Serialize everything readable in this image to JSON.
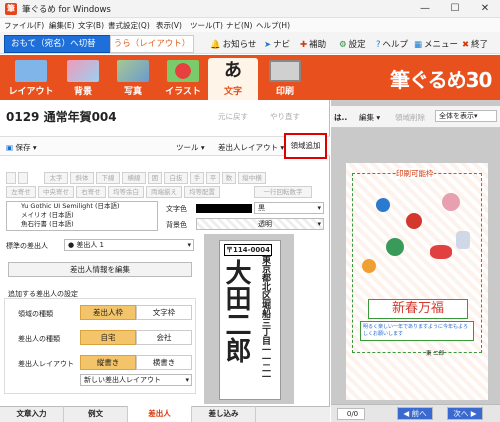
{
  "window": {
    "title": "筆ぐるめ for Windows",
    "minimize": "—",
    "maximize": "☐",
    "close": "✕"
  },
  "menu": [
    "ファイル(F)",
    "編集(E)",
    "文字(B)",
    "書式設定(Q)",
    "表示(V)",
    "ツール(T)",
    "ナビ(N)",
    "ヘルプ(H)"
  ],
  "toolbar": {
    "omote_tab": "おもて（宛名）へ切替",
    "ura_tab": "うら（レイアウト）",
    "items": [
      {
        "icon": "bell-icon",
        "label": "お知らせ",
        "color": "#d4380d"
      },
      {
        "icon": "arrow-icon",
        "label": "ナビ",
        "color": "#1a7ad0"
      },
      {
        "icon": "plus-icon",
        "label": "補助",
        "color": "#d4380d"
      },
      {
        "icon": "gear-icon",
        "label": "設定",
        "color": "#2a8a3a"
      },
      {
        "icon": "help-icon",
        "label": "ヘルプ",
        "color": "#1a7ad0"
      },
      {
        "icon": "menu-icon",
        "label": "メニュー",
        "color": "#1a7ad0"
      },
      {
        "icon": "close-icon",
        "label": "終了",
        "color": "#d4380d"
      }
    ]
  },
  "main_tabs": [
    {
      "label": "レイアウト",
      "color": "#7fb5e8"
    },
    {
      "label": "背景",
      "color": "#f29ab8"
    },
    {
      "label": "写真",
      "color": "#a8c890"
    },
    {
      "label": "イラスト",
      "color": "#7acb6a"
    },
    {
      "label": "文字",
      "color": "#ffffff"
    },
    {
      "label": "印刷",
      "color": "#d0d0d0"
    }
  ],
  "brand": "筆ぐるめ30",
  "document": {
    "title": "0129 通常年賀004",
    "undo": "元に戻す",
    "redo": "やり直す"
  },
  "controls": {
    "save": "保存",
    "tools": "ツール",
    "sender_layout": "差出人レイアウト",
    "add_area": "領域追加"
  },
  "format_rows": [
    [
      "太字",
      "斜体",
      "下線",
      "横線",
      "囲",
      "白抜",
      "手",
      "平",
      "数",
      "縦中横"
    ],
    [
      "左寄せ",
      "中央寄せ",
      "右寄せ",
      "均等余白",
      "両端揃え",
      "均等配置",
      "一行回転数字"
    ]
  ],
  "fonts": [
    "Yu Gothic UI Semilight (日本語)",
    "メイリオ (日本語)",
    "魚石行書 (日本語)"
  ],
  "color_panel": {
    "text_color_label": "文字色",
    "text_color_value": "黒",
    "bg_color_label": "背景色",
    "bg_color_value": "透明"
  },
  "sender": {
    "standard_label": "標準の差出人",
    "standard_value": "● 差出人 1",
    "edit_button": "差出人情報を編集",
    "section_title": "追加する差出人の設定",
    "area_type_label": "領域の種類",
    "area_type_options": [
      "差出人枠",
      "文字枠"
    ],
    "sender_type_label": "差出人の種類",
    "sender_type_options": [
      "自宅",
      "会社"
    ],
    "layout_label": "差出人レイアウト",
    "layout_options": [
      "縦書き",
      "横書き"
    ],
    "new_layout": "新しい差出人レイアウト"
  },
  "card_preview": {
    "postal": "〒114-0004",
    "address": "東京都北区堀船三丁目一一二一",
    "name": "大田二郎"
  },
  "bottom_tabs": [
    "文章入力",
    "例文",
    "差出人",
    "差し込み"
  ],
  "right_panel": {
    "toolbar_short": "は..",
    "edit": "編集",
    "delete_area": "領域削除",
    "view": "全体を表示",
    "print_area": "印刷可能枠",
    "greeting": "新春万福",
    "message": "明るく楽しい一年でありますように今年もよろしくお願いします",
    "sender_small": "東 二郎",
    "page": "0/0",
    "prev": "前へ",
    "next": "次へ"
  }
}
